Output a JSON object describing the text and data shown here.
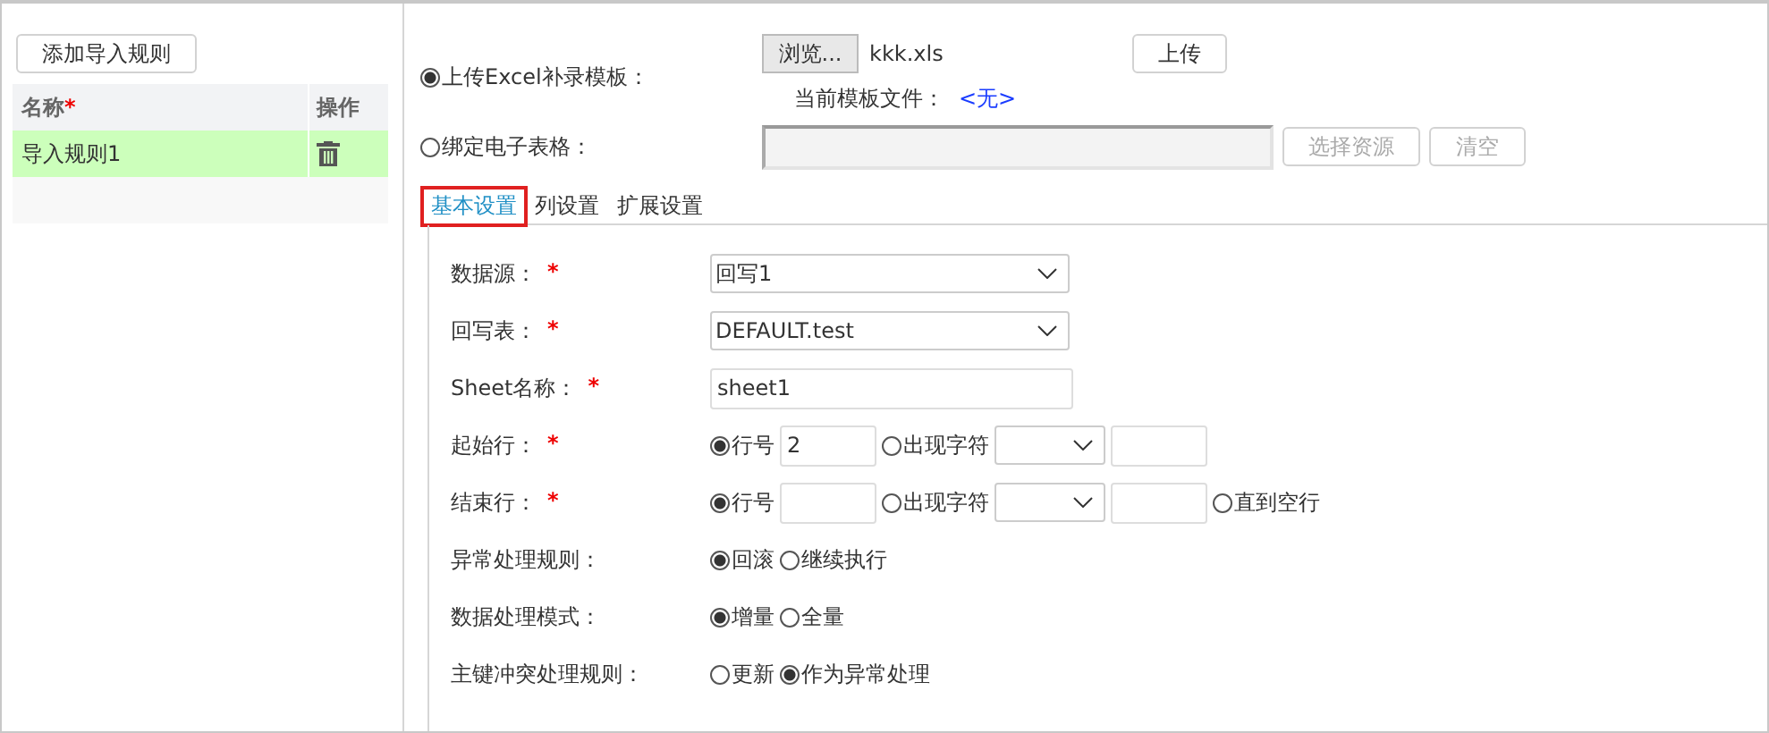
{
  "left_panel": {
    "add_button": "添加导入规则",
    "table": {
      "columns": [
        {
          "label": "名称",
          "required_mark": "*"
        },
        {
          "label": "操作"
        }
      ],
      "rows": [
        {
          "name": "导入规则1",
          "selected": true
        }
      ]
    }
  },
  "source": {
    "options": [
      {
        "label": "上传Excel补录模板：",
        "selected": true
      },
      {
        "label": "绑定电子表格：",
        "selected": false
      }
    ],
    "browse_button": "浏览...",
    "file_name": "kkk.xls",
    "upload_button": "上传",
    "current_template_label": "当前模板文件：",
    "current_template_value": "<无>",
    "choose_resource_button": {
      "label": "选择资源",
      "disabled": true
    },
    "clear_button": {
      "label": "清空",
      "disabled": true
    }
  },
  "tabs": [
    {
      "label": "基本设置",
      "selected": true
    },
    {
      "label": "列设置",
      "selected": false
    },
    {
      "label": "扩展设置",
      "selected": false
    }
  ],
  "form": [
    {
      "kind": "select",
      "label": "数据源：",
      "required": true,
      "value": "回写1"
    },
    {
      "kind": "select",
      "label": "回写表：",
      "required": true,
      "value": "DEFAULT.test"
    },
    {
      "kind": "text",
      "label": "Sheet名称：",
      "required": true,
      "value": "sheet1"
    },
    {
      "kind": "range",
      "label": "起始行：",
      "required": true,
      "options": [
        {
          "kind": "number",
          "label": "行号",
          "selected": true,
          "value": "2"
        },
        {
          "kind": "char",
          "label": "出现字符",
          "selected": false
        }
      ]
    },
    {
      "kind": "range",
      "label": "结束行：",
      "required": true,
      "options": [
        {
          "kind": "number",
          "label": "行号",
          "selected": true
        },
        {
          "kind": "char",
          "label": "出现字符",
          "selected": false
        },
        {
          "kind": "plain",
          "label": "直到空行",
          "selected": false
        }
      ]
    },
    {
      "kind": "radio",
      "label": "异常处理规则：",
      "required": false,
      "options": [
        {
          "label": "回滚",
          "selected": true
        },
        {
          "label": "继续执行",
          "selected": false
        }
      ]
    },
    {
      "kind": "radio",
      "label": "数据处理模式：",
      "required": false,
      "options": [
        {
          "label": "增量",
          "selected": true
        },
        {
          "label": "全量",
          "selected": false
        }
      ]
    },
    {
      "kind": "radio",
      "label": "主键冲突处理规则：",
      "required": false,
      "options": [
        {
          "label": "更新",
          "selected": false
        },
        {
          "label": "作为异常处理",
          "selected": true
        }
      ]
    }
  ]
}
